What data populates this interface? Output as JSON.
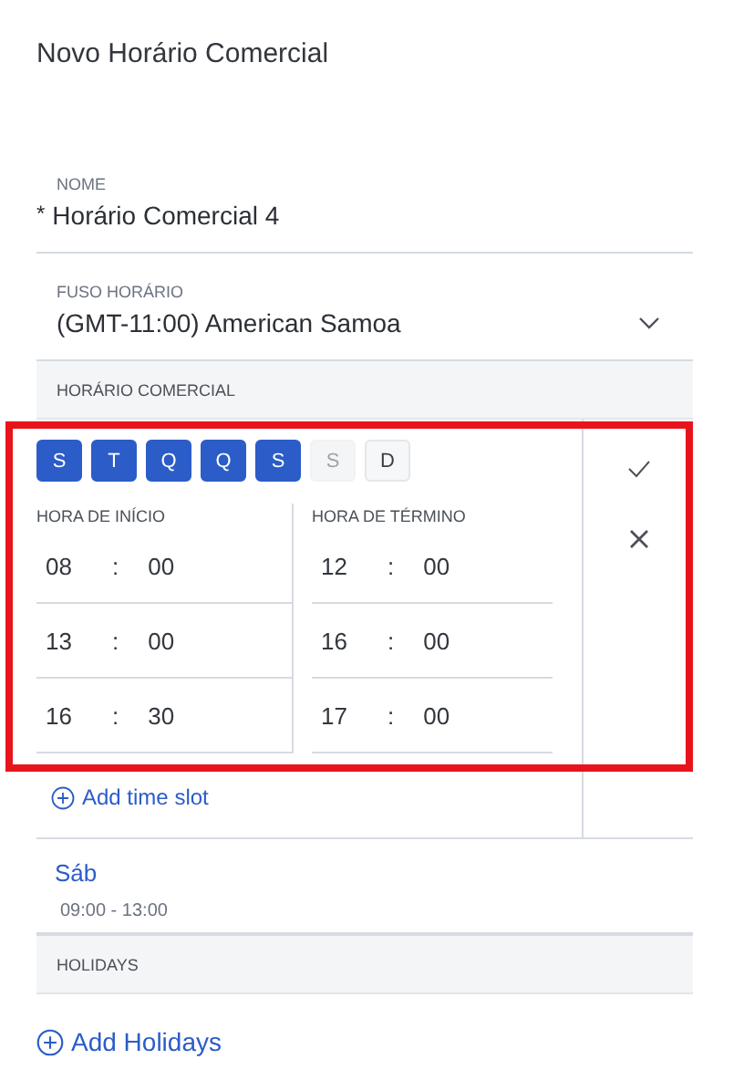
{
  "title": "Novo Horário Comercial",
  "name_field": {
    "label": "NOME",
    "required_mark": "*",
    "value": "Horário Comercial 4"
  },
  "timezone_field": {
    "label": "FUSO HORÁRIO",
    "value": "(GMT-11:00) American Samoa"
  },
  "business_hours": {
    "header": "HORÁRIO COMERCIAL",
    "highlighted": true,
    "days": [
      {
        "label": "S",
        "selected": true,
        "disabled": false
      },
      {
        "label": "T",
        "selected": true,
        "disabled": false
      },
      {
        "label": "Q",
        "selected": true,
        "disabled": false
      },
      {
        "label": "Q",
        "selected": true,
        "disabled": false
      },
      {
        "label": "S",
        "selected": true,
        "disabled": false
      },
      {
        "label": "S",
        "selected": false,
        "disabled": true
      },
      {
        "label": "D",
        "selected": false,
        "disabled": false
      }
    ],
    "columns": [
      "HORA DE INÍCIO",
      "HORA DE TÉRMINO"
    ],
    "slots": [
      {
        "start_hour": "08",
        "start_minute": "00",
        "end_hour": "12",
        "end_minute": "00"
      },
      {
        "start_hour": "13",
        "start_minute": "00",
        "end_hour": "16",
        "end_minute": "00"
      },
      {
        "start_hour": "16",
        "start_minute": "30",
        "end_hour": "17",
        "end_minute": "00"
      }
    ],
    "separator": ":",
    "add_slot": "Add time slot",
    "saved": [
      {
        "day": "Sáb",
        "hours": "09:00 - 13:00"
      }
    ]
  },
  "holidays": {
    "header": "HOLIDAYS",
    "add": "Add Holidays"
  }
}
